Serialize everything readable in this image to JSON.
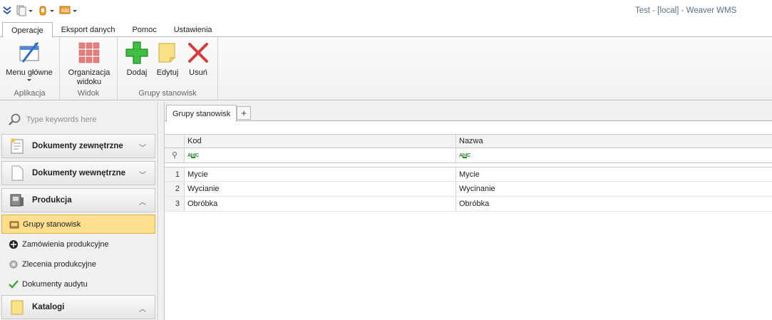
{
  "window": {
    "title": "Test - [local] - Weaver WMS"
  },
  "quick_access": {
    "items": [
      {
        "icon": "chevrons-down-icon"
      },
      {
        "icon": "document-icon"
      },
      {
        "icon": "hand-icon"
      },
      {
        "icon": "spellcheck-abc-icon",
        "text": "ABC"
      }
    ]
  },
  "ribbon_tabs": [
    "Operacje",
    "Eksport danych",
    "Pomoc",
    "Ustawienia"
  ],
  "ribbon": {
    "groups": [
      {
        "title": "Aplikacja",
        "buttons": [
          {
            "label": "Menu główne",
            "icon": "main-menu-icon",
            "has_dropdown": true
          }
        ]
      },
      {
        "title": "Widok",
        "buttons": [
          {
            "label_line1": "Organizacja",
            "label_line2": "widoku",
            "icon": "grid-layout-icon",
            "has_dropdown": true
          }
        ]
      },
      {
        "title": "Grupy stanowisk",
        "buttons": [
          {
            "label": "Dodaj",
            "icon": "add-icon"
          },
          {
            "label": "Edytuj",
            "icon": "edit-icon"
          },
          {
            "label": "Usuń",
            "icon": "delete-icon"
          }
        ]
      }
    ]
  },
  "sidebar": {
    "search_placeholder": "Type keywords here",
    "groups": [
      {
        "label": "Dokumenty zewnętrzne",
        "icon": "external-documents-icon",
        "expanded": false
      },
      {
        "label": "Dokumenty wewnętrzne",
        "icon": "internal-documents-icon",
        "expanded": false
      },
      {
        "label": "Produkcja",
        "icon": "production-icon",
        "expanded": true
      },
      {
        "label": "Katalogi",
        "icon": "catalogs-icon",
        "expanded": true
      }
    ],
    "production_items": [
      {
        "label": "Grupy stanowisk",
        "icon": "workstation-groups-icon",
        "selected": true
      },
      {
        "label": "Zamówienia produkcyjne",
        "icon": "production-orders-icon",
        "selected": false
      },
      {
        "label": "Zlecenia produkcyjne",
        "icon": "gear-icon",
        "selected": false
      },
      {
        "label": "Dokumenty audytu",
        "icon": "checkmark-icon",
        "selected": false
      }
    ]
  },
  "document_tabs": [
    {
      "label": "Grupy stanowisk",
      "active": true
    }
  ],
  "add_tab_label": "+",
  "grid": {
    "columns": [
      "Kod",
      "Nazwa"
    ],
    "filter_icon": "pin-icon",
    "filter_placeholder": "ABC",
    "rows": [
      {
        "num": "1",
        "kod": "Mycie",
        "nazwa": "Mycie"
      },
      {
        "num": "2",
        "kod": "Wycianie",
        "nazwa": "Wycinanie"
      },
      {
        "num": "3",
        "kod": "Obróbka",
        "nazwa": "Obróbka"
      }
    ]
  },
  "colors": {
    "selected_bg": "#fddf8e",
    "selected_border": "#e3b04b",
    "title_text": "#5a6e8c"
  }
}
